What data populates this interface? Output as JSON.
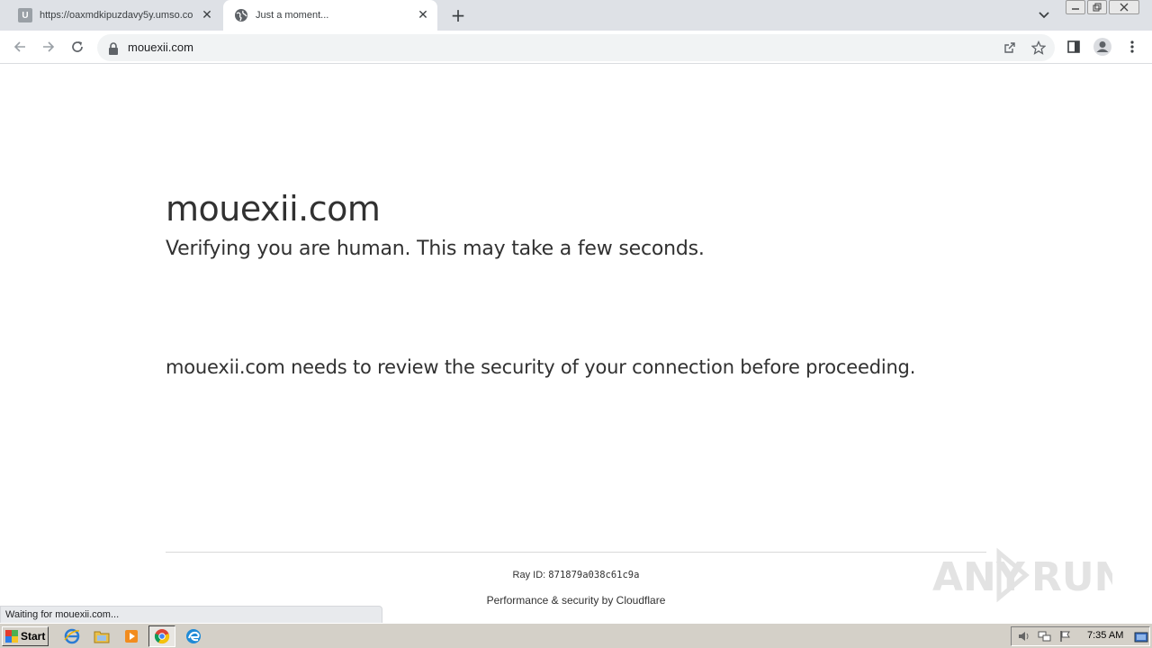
{
  "browser": {
    "tabs": [
      {
        "title": "https://oaxmdkipuzdavy5y.umso.co",
        "favicon": "U",
        "active": false
      },
      {
        "title": "Just a moment...",
        "favicon": "globe-icon",
        "active": true
      }
    ],
    "new_tab_label": "+",
    "address": "mouexii.com",
    "status_text": "Waiting for mouexii.com..."
  },
  "page": {
    "heading": "mouexii.com",
    "subheading": "Verifying you are human. This may take a few seconds.",
    "review_text": "mouexii.com needs to review the security of your connection before proceeding.",
    "ray_label": "Ray ID:",
    "ray_id": "871879a038c61c9a",
    "footer": "Performance & security by Cloudflare"
  },
  "watermark": {
    "text": "ANY RUN"
  },
  "taskbar": {
    "start_label": "Start",
    "clock": "7:35 AM"
  },
  "colors": {
    "tabstrip": "#dee1e6",
    "text": "#313131",
    "taskbar": "#d4d0c8"
  }
}
